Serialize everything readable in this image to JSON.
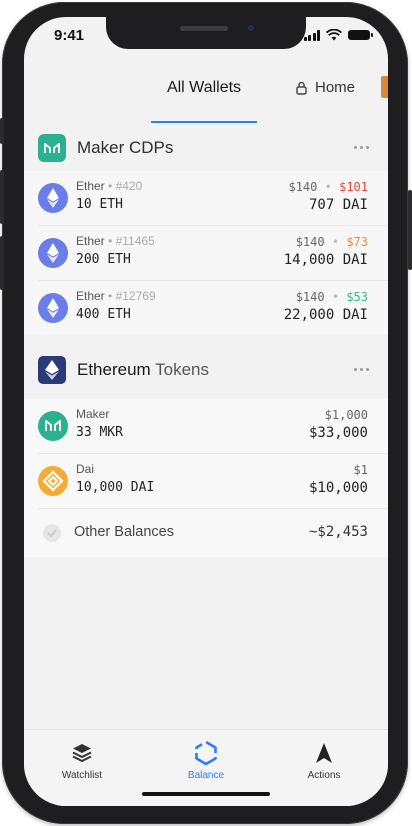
{
  "status_bar": {
    "time": "9:41"
  },
  "tabs": {
    "all_wallets": "All Wallets",
    "home": "Home"
  },
  "maker_cdps": {
    "title": "Maker CDPs",
    "rows": [
      {
        "asset": "Ether",
        "id": "#420",
        "amount": "10",
        "unit": "ETH",
        "price": "$140",
        "change": "$101",
        "change_color": "#e5433b",
        "dai": "707",
        "dai_unit": "DAI"
      },
      {
        "asset": "Ether",
        "id": "#11465",
        "amount": "200",
        "unit": "ETH",
        "price": "$140",
        "change": "$73",
        "change_color": "#f08a30",
        "dai": "14,000",
        "dai_unit": "DAI"
      },
      {
        "asset": "Ether",
        "id": "#12769",
        "amount": "400",
        "unit": "ETH",
        "price": "$140",
        "change": "$53",
        "change_color": "#35b88f",
        "dai": "22,000",
        "dai_unit": "DAI"
      }
    ]
  },
  "ethereum_tokens": {
    "title_a": "Ethereum",
    "title_b": "Tokens",
    "rows": [
      {
        "name": "Maker",
        "amount": "33",
        "unit": "MKR",
        "price": "$1,000",
        "value": "$33,000",
        "icon": "maker-token-icon"
      },
      {
        "name": "Dai",
        "amount": "10,000",
        "unit": "DAI",
        "price": "$1",
        "value": "$10,000",
        "icon": "dai-token-icon"
      }
    ],
    "other_label": "Other Balances",
    "other_value": "~$2,453"
  },
  "bottom_nav": {
    "watchlist": "Watchlist",
    "balance": "Balance",
    "actions": "Actions",
    "active": "balance",
    "accent_color": "#2f7df6"
  }
}
